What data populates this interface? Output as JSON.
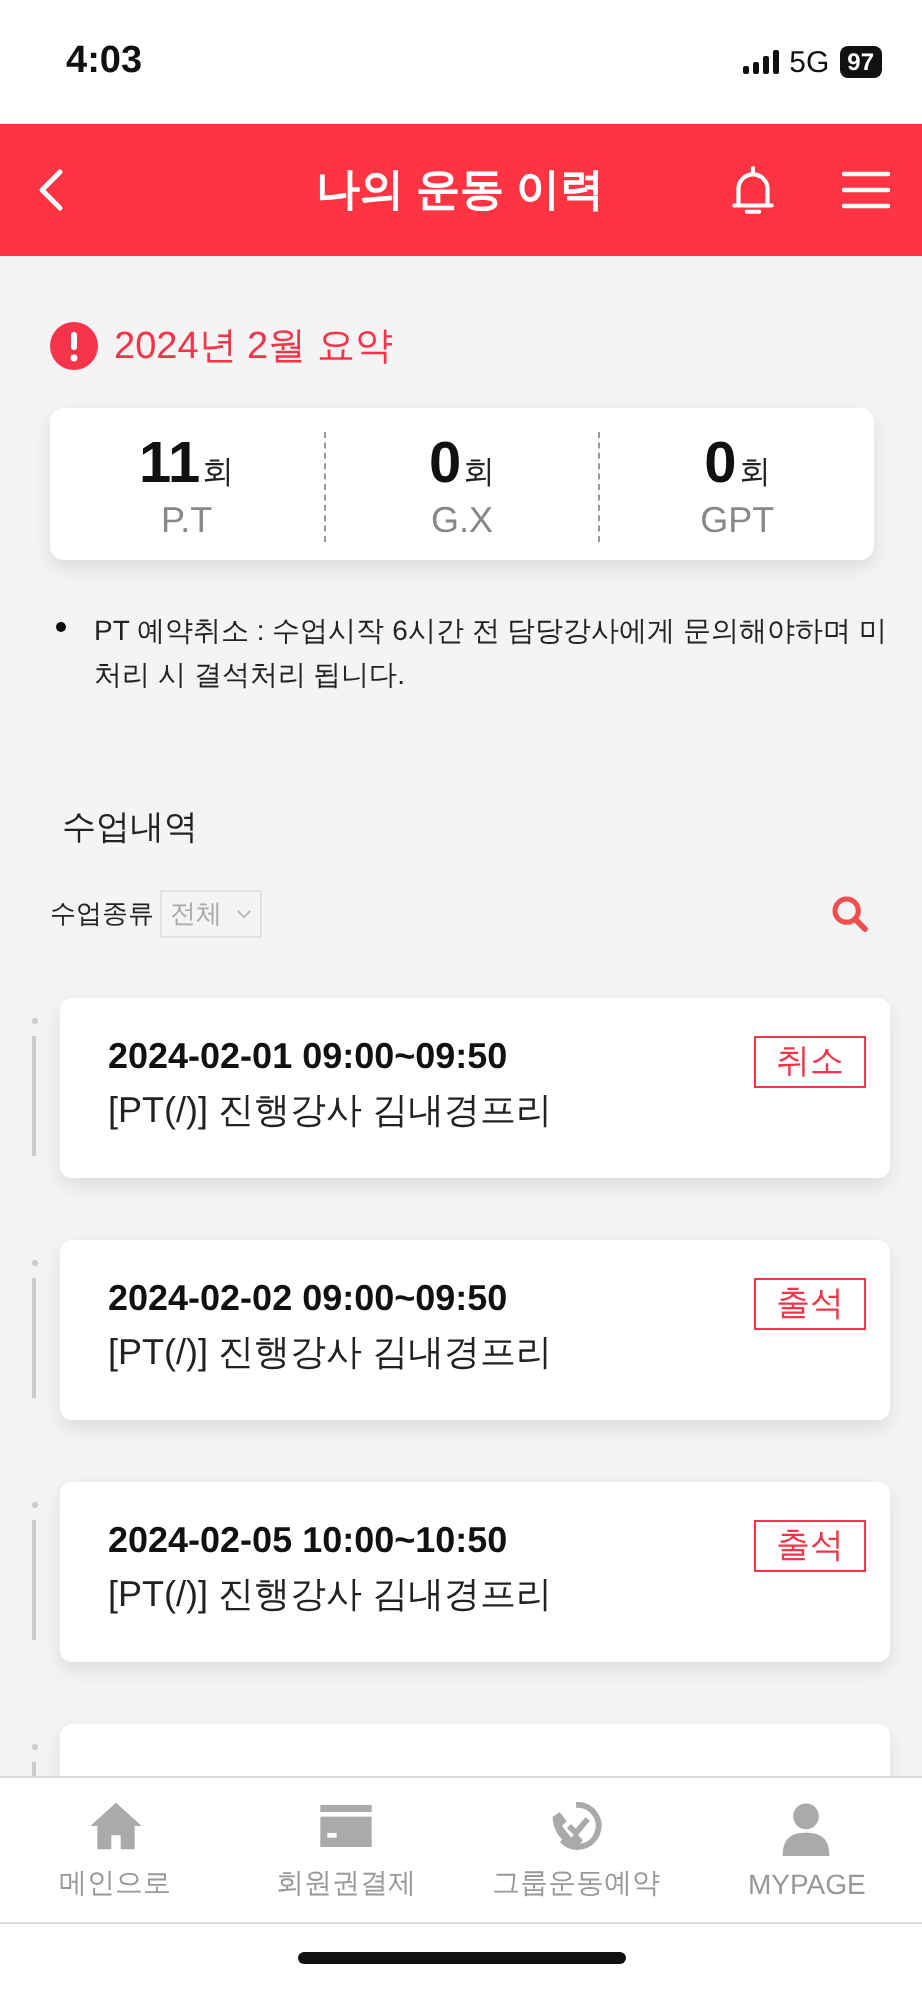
{
  "status_bar": {
    "time": "4:03",
    "network": "5G",
    "battery": "97"
  },
  "header": {
    "title": "나의 운동 이력"
  },
  "summary": {
    "title": "2024년 2월 요약",
    "stats": [
      {
        "count": "11",
        "unit": "회",
        "label": "P.T"
      },
      {
        "count": "0",
        "unit": "회",
        "label": "G.X"
      },
      {
        "count": "0",
        "unit": "회",
        "label": "GPT"
      }
    ]
  },
  "notices": [
    "PT 예약취소 : 수업시작 6시간 전 담당강사에게 문의해야하며 미처리 시 결석처리 됩니다."
  ],
  "section": {
    "title": "수업내역"
  },
  "filter": {
    "label": "수업종류",
    "value": "전체"
  },
  "classes": [
    {
      "datetime": "2024-02-01 09:00~09:50",
      "detail": "[PT(/)] 진행강사 김내경프리",
      "status": "취소"
    },
    {
      "datetime": "2024-02-02 09:00~09:50",
      "detail": "[PT(/)] 진행강사 김내경프리",
      "status": "출석"
    },
    {
      "datetime": "2024-02-05 10:00~10:50",
      "detail": "[PT(/)] 진행강사 김내경프리",
      "status": "출석"
    },
    {
      "kind": "clipped"
    }
  ],
  "tab_bar": [
    {
      "kind": "home",
      "label": "메인으로"
    },
    {
      "kind": "card",
      "label": "회원권결제"
    },
    {
      "kind": "phone",
      "label": "그룹운동예약"
    },
    {
      "kind": "person",
      "label": "MYPAGE"
    }
  ]
}
